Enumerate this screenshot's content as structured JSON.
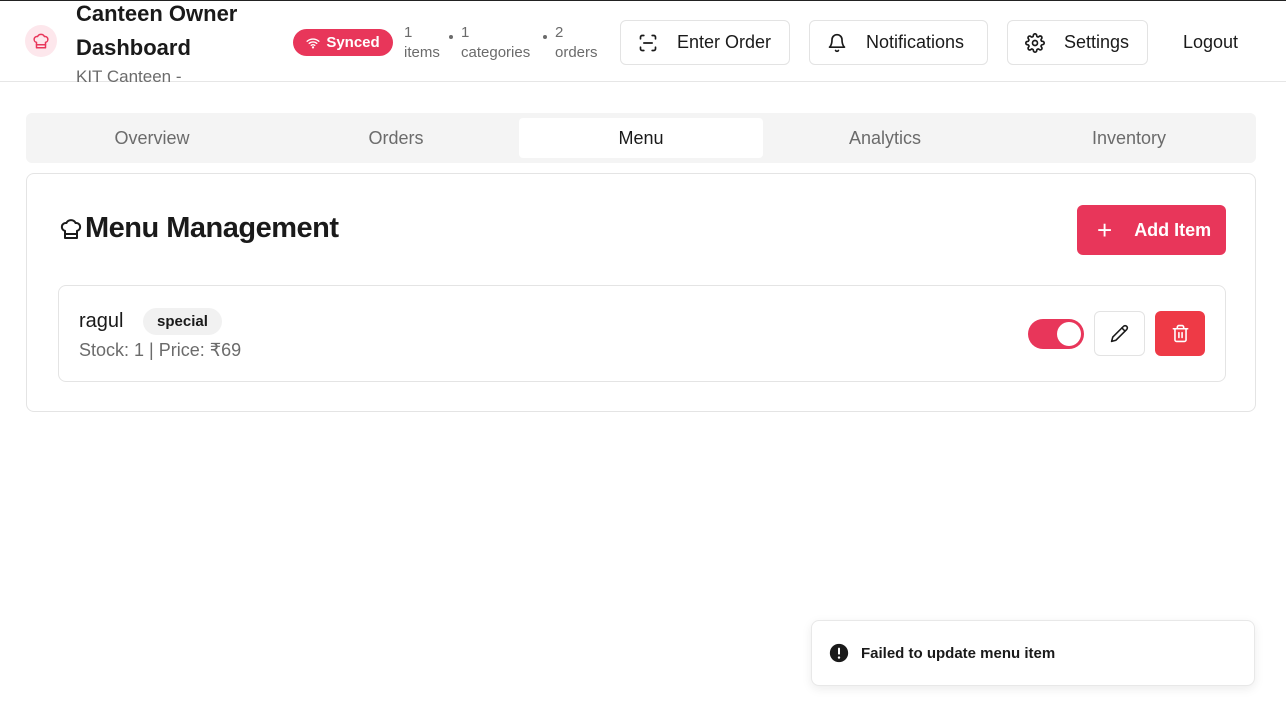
{
  "header": {
    "logo_icon": "chef-hat-icon",
    "title": "Canteen Owner Dashboard",
    "subtitle": "KIT Canteen -",
    "sync_status": "Synced",
    "stats": [
      {
        "value": "1",
        "label": "items"
      },
      {
        "value": "1",
        "label": "categories"
      },
      {
        "value": "2",
        "label": "orders"
      }
    ],
    "buttons": {
      "enter_order": "Enter Order",
      "notifications": "Notifications",
      "settings": "Settings",
      "logout": "Logout"
    }
  },
  "tabs": [
    {
      "label": "Overview",
      "active": false
    },
    {
      "label": "Orders",
      "active": false
    },
    {
      "label": "Menu",
      "active": true
    },
    {
      "label": "Analytics",
      "active": false
    },
    {
      "label": "Inventory",
      "active": false
    }
  ],
  "menu": {
    "title": "Menu Management",
    "add_label": "Add Item",
    "items": [
      {
        "name": "ragul",
        "category": "special",
        "meta": "Stock: 1 | Price: ₹69",
        "available": true
      }
    ]
  },
  "toast": {
    "message": "Failed to update menu item"
  },
  "colors": {
    "accent": "#e8365a",
    "danger": "#ee3a46"
  }
}
